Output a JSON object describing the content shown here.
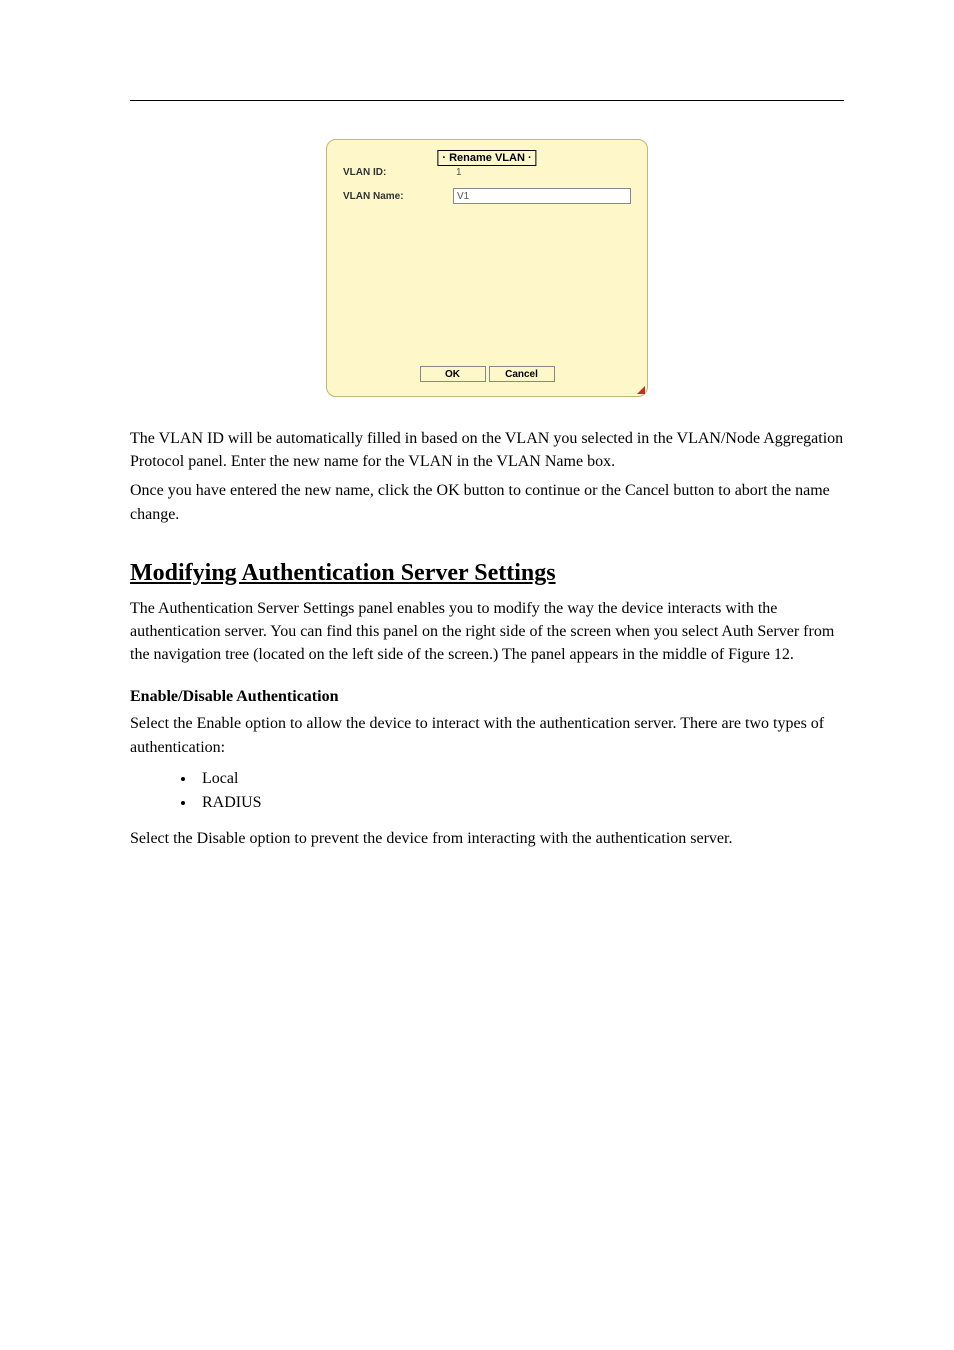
{
  "dialog": {
    "title": "· Rename VLAN ·",
    "vlan_id_label": "VLAN ID:",
    "vlan_id_value": "1",
    "vlan_name_label": "VLAN Name:",
    "vlan_name_value": "V1",
    "ok_label": "OK",
    "cancel_label": "Cancel"
  },
  "para1": "The VLAN ID will be automatically filled in based on the VLAN you selected in the VLAN/Node Aggregation Protocol panel. Enter the new name for the VLAN in the VLAN Name box.",
  "para2": "Once you have entered the new name, click the OK button to continue or the Cancel button to abort the name change.",
  "section_heading": "Modifying Authentication Server Settings",
  "section_p1": "The Authentication Server Settings panel enables you to modify the way the device interacts with the authentication server. You can find this panel on the right side of the screen when you select Auth Server from the navigation tree (located on the left side of the screen.) The panel appears in the middle of Figure 12.",
  "subhead_enable": "Enable/Disable Authentication",
  "enable_p1": "Select the Enable option to allow the device to interact with the authentication server. There are two types of authentication:",
  "bullets": [
    "Local",
    "RADIUS"
  ],
  "enable_p2": "Select the Disable option to prevent the device from interacting with the authentication server."
}
